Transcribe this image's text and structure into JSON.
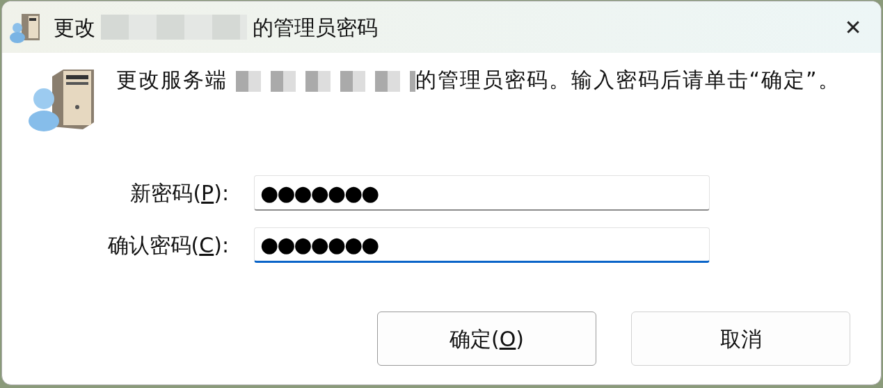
{
  "window": {
    "title_start": "更改",
    "title_redacted": true,
    "title_end": "的管理员密码",
    "close": "✕"
  },
  "message": {
    "start": "更改服务端",
    "redacted": true,
    "end": "的管理员密码。输入密码后请单击“确定”。"
  },
  "fields": [
    {
      "label_before": "新密码(",
      "access_key": "P",
      "label_after": "):",
      "value": "●●●●●●●",
      "focused": false
    },
    {
      "label_before": "确认密码(",
      "access_key": "C",
      "label_after": "):",
      "value": "●●●●●●●",
      "focused": true
    }
  ],
  "buttons": [
    {
      "label_before": "确定(",
      "access_key": "O",
      "label_after": ")",
      "default": true
    },
    {
      "label": "取消",
      "default": false
    }
  ]
}
